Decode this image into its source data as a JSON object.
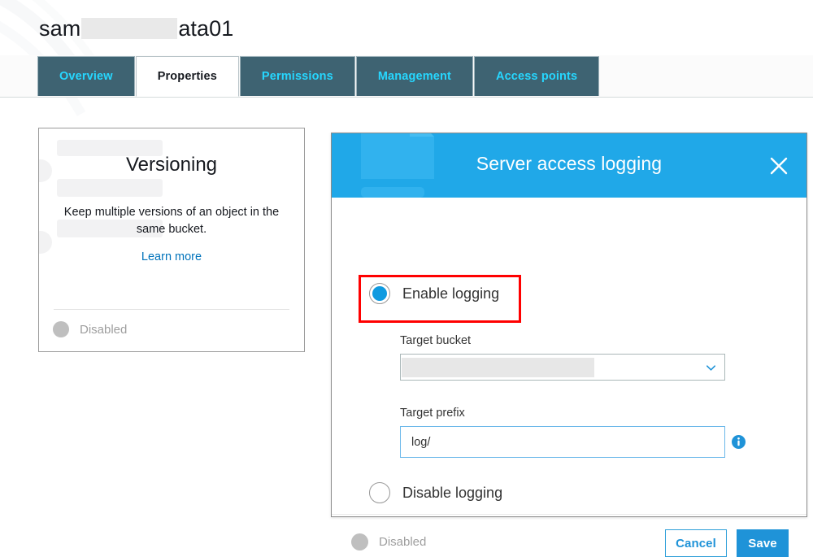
{
  "page": {
    "title_prefix": "sam",
    "title_suffix": "ata01",
    "title_redacted": true
  },
  "tabs": [
    {
      "label": "Overview",
      "active": false
    },
    {
      "label": "Properties",
      "active": true
    },
    {
      "label": "Permissions",
      "active": false
    },
    {
      "label": "Management",
      "active": false
    },
    {
      "label": "Access points",
      "active": false
    }
  ],
  "versioning_card": {
    "title": "Versioning",
    "description": "Keep multiple versions of an object in the same bucket.",
    "link_label": "Learn more",
    "status_label": "Disabled"
  },
  "modal": {
    "title": "Server access logging",
    "close_label": "×",
    "options": {
      "enable": {
        "label": "Enable logging",
        "selected": true
      },
      "disable": {
        "label": "Disable logging",
        "selected": false
      }
    },
    "target_bucket": {
      "label": "Target bucket",
      "value": "",
      "redacted": true
    },
    "target_prefix": {
      "label": "Target prefix",
      "value": "log/",
      "placeholder": ""
    },
    "status_label": "Disabled",
    "cancel_label": "Cancel",
    "save_label": "Save"
  },
  "colors": {
    "accent_blue": "#1f93d8",
    "header_blue": "#20a8e8",
    "tab_bg": "#3e6372",
    "tab_text": "#26d7ff",
    "link_blue": "#0073bb",
    "highlight_red": "#ff0000",
    "disabled_grey": "#bfbfbf"
  }
}
